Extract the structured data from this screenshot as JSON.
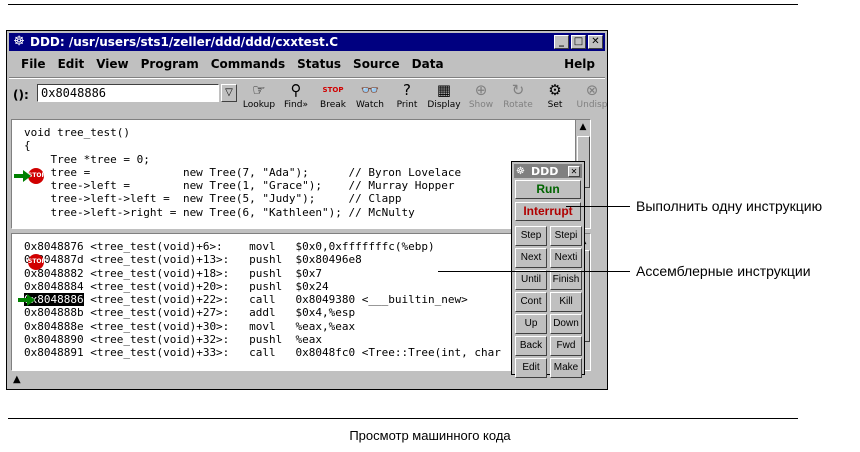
{
  "window": {
    "title": "DDD: /usr/users/sts1/zeller/ddd/ddd/cxxtest.C",
    "buttons": [
      "_",
      "□",
      "✕"
    ]
  },
  "menubar": {
    "items": [
      "File",
      "Edit",
      "View",
      "Program",
      "Commands",
      "Status",
      "Source",
      "Data"
    ],
    "help": "Help"
  },
  "toolbar": {
    "arg_label": "():",
    "arg_value": "0x8048886",
    "tools": [
      {
        "label": "Lookup",
        "icon": "lookup-icon",
        "glyph": "☞",
        "enabled": true
      },
      {
        "label": "Find»",
        "icon": "find-icon",
        "glyph": "⚲",
        "enabled": true
      },
      {
        "label": "Break",
        "icon": "break-icon",
        "glyph": "STOP",
        "enabled": true
      },
      {
        "label": "Watch",
        "icon": "watch-icon",
        "glyph": "👓",
        "enabled": true
      },
      {
        "label": "Print",
        "icon": "print-icon",
        "glyph": "?",
        "enabled": true
      },
      {
        "label": "Display",
        "icon": "display-icon",
        "glyph": "▦",
        "enabled": true
      },
      {
        "label": "Show",
        "icon": "show-icon",
        "glyph": "⊕",
        "enabled": false
      },
      {
        "label": "Rotate",
        "icon": "rotate-icon",
        "glyph": "↻",
        "enabled": false
      },
      {
        "label": "Set",
        "icon": "set-icon",
        "glyph": "⚙",
        "enabled": true
      },
      {
        "label": "Undisp",
        "icon": "undisp-icon",
        "glyph": "⊗",
        "enabled": false
      }
    ]
  },
  "source": {
    "lines": [
      "void tree_test()",
      "{",
      "    Tree *tree = 0;",
      "    tree =              new Tree(7, \"Ada\");      // Byron Lovelace",
      "    tree->left =        new Tree(1, \"Grace\");    // Murray Hopper",
      "    tree->left->left =  new Tree(5, \"Judy\");     // Clapp",
      "    tree->left->right = new Tree(6, \"Kathleen\"); // McNulty"
    ]
  },
  "assembly": {
    "lines": [
      [
        "0x8048876",
        " <tree_test(void)+6>:    movl   $0x0,0xfffffffc(%ebp)"
      ],
      [
        "0x804887d",
        " <tree_test(void)+13>:   pushl  $0x80496e8"
      ],
      [
        "0x8048882",
        " <tree_test(void)+18>:   pushl  $0x7"
      ],
      [
        "0x8048884",
        " <tree_test(void)+20>:   pushl  $0x24"
      ],
      [
        "0x8048886",
        " <tree_test(void)+22>:   call   0x8049380 <___builtin_new>"
      ],
      [
        "0x804888b",
        " <tree_test(void)+27>:   addl   $0x4,%esp"
      ],
      [
        "0x804888e",
        " <tree_test(void)+30>:   movl   %eax,%eax"
      ],
      [
        "0x8048890",
        " <tree_test(void)+32>:   pushl  %eax"
      ],
      [
        "0x8048891",
        " <tree_test(void)+33>:   call   0x8048fc0 <Tree::Tree(int, char"
      ]
    ],
    "highlight_index": 4
  },
  "command_tool": {
    "title": "DDD",
    "run": "Run",
    "interrupt": "Interrupt",
    "buttons": [
      [
        "Step",
        "Stepi"
      ],
      [
        "Next",
        "Nexti"
      ],
      [
        "Until",
        "Finish"
      ],
      [
        "Cont",
        "Kill"
      ],
      [
        "Up",
        "Down"
      ],
      [
        "Back",
        "Fwd"
      ],
      [
        "Edit",
        "Make"
      ]
    ]
  },
  "annotations": {
    "stepi": "Выполнить одну инструкцию",
    "assembly": "Ассемблерные инструкции"
  },
  "caption": "Просмотр машинного кода",
  "colors": {
    "title": "#000080",
    "run": "#006400",
    "interrupt": "#b00000",
    "stop": "#d00000",
    "arrow": "#008000"
  }
}
